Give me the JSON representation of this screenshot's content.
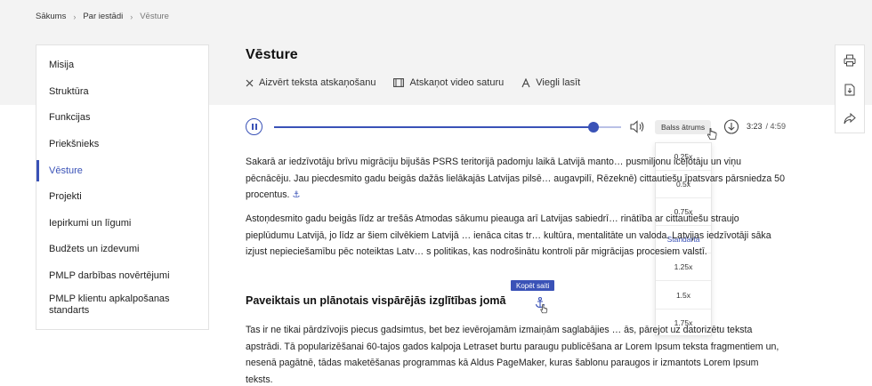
{
  "breadcrumb": {
    "items": [
      "Sākums",
      "Par iestādi",
      "Vēsture"
    ],
    "separator": "›"
  },
  "sidebar": {
    "items": [
      {
        "label": "Misija"
      },
      {
        "label": "Struktūra"
      },
      {
        "label": "Funkcijas"
      },
      {
        "label": "Priekšnieks"
      },
      {
        "label": "Vēsture",
        "active": true
      },
      {
        "label": "Projekti"
      },
      {
        "label": "Iepirkumi un līgumi"
      },
      {
        "label": "Budžets un izdevumi"
      },
      {
        "label": "PMLP darbības novērtējumi"
      },
      {
        "label": "PMLP klientu apkalpošanas standarts"
      }
    ]
  },
  "page": {
    "title": "Vēsture"
  },
  "actions": {
    "close_tts": "Aizvērt teksta atskaņošanu",
    "play_video": "Atskaņot video saturu",
    "easy_read": "Viegli lasīt"
  },
  "player": {
    "progress": 0.92,
    "speed_label": "Balss ātrums",
    "current_time": "3:23",
    "total_time": "/ 4:59"
  },
  "speed_menu": {
    "options": [
      "0.25x",
      "0.5x",
      "0.75x",
      "Standarta",
      "1.25x",
      "1.5x",
      "1.75x"
    ],
    "selected": "Standarta"
  },
  "content": {
    "p1": "Sakarā ar iedzīvotāju brīvu migrāciju bijušās PSRS teritorijā padomju laikā Latvijā manto… pusmiljonu iceļotāju un viņu pēcnācēju. Jau piecdesmito gadu beigās dažās lielākajās Latvijas pilsē… augavpilī, Rēzeknē) cittautiešu īpatsvars pārsniedza 50 procentus.",
    "p2": "Astoņdesmito gadu beigās līdz ar trešās Atmodas sākumu pieauga arī Latvijas sabiedrī… rinātība ar cittautiešu straujo pieplūdumu Latvijā, jo līdz ar šiem cilvēkiem Latvijā … ienāca citas tr… kultūra, mentalitāte un valoda. Latvijas iedzīvotāji sāka izjust nepieciešamību pēc noteiktas Latv… s politikas, kas nodrošinātu kontroli pār migrācijas procesiem valstī.",
    "heading": "Paveiktais un plānotais vispārējās izglītības jomā",
    "tooltip": "Kopēt saiti",
    "p3": "Tas ir ne tikai pārdzīvojis piecus gadsimtus, bet bez ievērojamām izmaiņām saglabājies … ās, pārejot uz datorizētu teksta apstrādi. Tā popularizēšanai 60-tajos gados kalpoja Letraset burtu paraugu publicēšana ar Lorem Ipsum teksta fragmentiem un, nesenā pagātnē, tādas maketēšanas programmas kā Aldus PageMaker, kuras šablonu paraugos ir izmantots Lorem Ipsum teksts."
  },
  "colors": {
    "accent": "#3a52b7",
    "band": "#f3f3f3"
  },
  "icons": {
    "right_tools": [
      "print-icon",
      "pdf-download-icon",
      "share-icon"
    ],
    "player": [
      "pause-icon",
      "volume-icon",
      "download-icon"
    ]
  }
}
